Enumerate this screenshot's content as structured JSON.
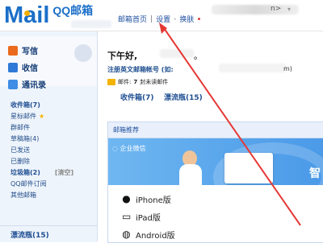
{
  "header": {
    "logo_text": "Mail",
    "logo_sub": "QQ邮箱",
    "user_suffix": "n>",
    "links": [
      "邮箱首页",
      "设置",
      "换肤"
    ]
  },
  "sidebar": {
    "tools": [
      {
        "label": "写信",
        "color": "#ea6b1d"
      },
      {
        "label": "收信",
        "color": "#2f7ad8"
      },
      {
        "label": "通讯录",
        "color": "#3f8de4"
      }
    ],
    "folders": [
      {
        "label": "收件箱(7)",
        "bold": true
      },
      {
        "label": "星标邮件"
      },
      {
        "label": "群邮件"
      },
      {
        "label": "草稿箱(4)"
      },
      {
        "label": "已发送"
      },
      {
        "label": "已删除"
      },
      {
        "label": "垃圾箱(2)",
        "bold": true
      },
      {
        "label": "QQ邮件订阅"
      },
      {
        "label": "其他邮箱"
      }
    ],
    "clear_label": "[清空]",
    "bottle_label": "漂流瓶(15)"
  },
  "main": {
    "greeting": "下午好,",
    "greeting_suffix": "。",
    "register_text": "注册英文邮箱帐号 (如:",
    "register_suffix": "m)",
    "mail_label": "邮件:",
    "mail_count": "7",
    "mail_suffix": "封未读邮件",
    "inbox_link": "收件箱(7)",
    "bottle_link": "漂流瓶(15)",
    "recommend_title": "邮箱推荐",
    "banner_label": "企业微信",
    "banner_right": "智",
    "devices": [
      "iPhone版",
      "iPad版",
      "Android版"
    ]
  }
}
